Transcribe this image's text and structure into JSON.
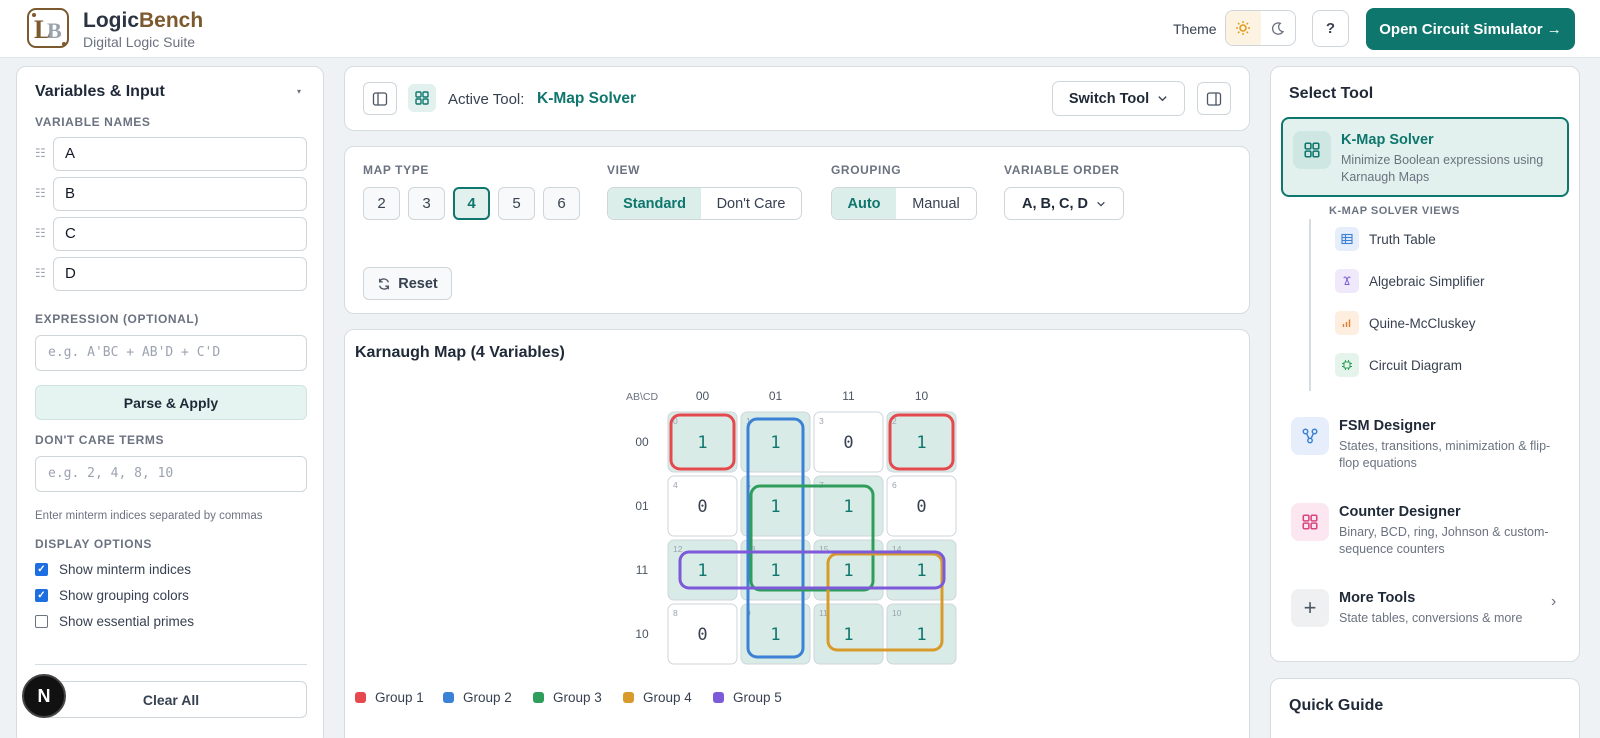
{
  "header": {
    "brand_logic": "Logic",
    "brand_bench": "Bench",
    "subtitle": "Digital Logic Suite",
    "theme_label": "Theme",
    "help_label": "?",
    "open_sim_label": "Open Circuit Simulator →"
  },
  "left_panel": {
    "title": "Variables & Input",
    "variable_names_label": "VARIABLE NAMES",
    "variables": [
      "A",
      "B",
      "C",
      "D"
    ],
    "expression_label": "EXPRESSION (OPTIONAL)",
    "expression_placeholder": "e.g. A'BC + AB'D + C'D",
    "parse_button": "Parse & Apply",
    "dont_care_label": "DON'T CARE TERMS",
    "dont_care_placeholder": "e.g. 2, 4, 8, 10",
    "dont_care_hint": "Enter minterm indices separated by commas",
    "display_options_label": "DISPLAY OPTIONS",
    "options": [
      {
        "label": "Show minterm indices",
        "checked": true
      },
      {
        "label": "Show grouping colors",
        "checked": true
      },
      {
        "label": "Show essential primes",
        "checked": false
      }
    ],
    "clear_button": "Clear All"
  },
  "toolbar": {
    "active_label": "Active Tool:",
    "active_tool": "K-Map Solver",
    "switch_label": "Switch Tool"
  },
  "controls": {
    "map_type_label": "MAP TYPE",
    "map_types": [
      "2",
      "3",
      "4",
      "5",
      "6"
    ],
    "map_type_selected": "4",
    "view_label": "VIEW",
    "view_options": [
      "Standard",
      "Don't Care"
    ],
    "view_selected": "Standard",
    "grouping_label": "GROUPING",
    "grouping_options": [
      "Auto",
      "Manual"
    ],
    "grouping_selected": "Auto",
    "order_label": "VARIABLE ORDER",
    "order_value": "A, B, C, D",
    "reset_label": "Reset"
  },
  "kmap": {
    "title": "Karnaugh Map (4 Variables)",
    "corner_label": "AB\\CD",
    "col_headers": [
      "00",
      "01",
      "11",
      "10"
    ],
    "row_headers": [
      "00",
      "01",
      "11",
      "10"
    ],
    "cells": [
      [
        {
          "idx": "0",
          "val": "1"
        },
        {
          "idx": "1",
          "val": "1"
        },
        {
          "idx": "3",
          "val": "0"
        },
        {
          "idx": "2",
          "val": "1"
        }
      ],
      [
        {
          "idx": "4",
          "val": "0"
        },
        {
          "idx": "5",
          "val": "1"
        },
        {
          "idx": "7",
          "val": "1"
        },
        {
          "idx": "6",
          "val": "0"
        }
      ],
      [
        {
          "idx": "12",
          "val": "1"
        },
        {
          "idx": "13",
          "val": "1"
        },
        {
          "idx": "15",
          "val": "1"
        },
        {
          "idx": "14",
          "val": "1"
        }
      ],
      [
        {
          "idx": "8",
          "val": "0"
        },
        {
          "idx": "9",
          "val": "1"
        },
        {
          "idx": "11",
          "val": "1"
        },
        {
          "idx": "10",
          "val": "1"
        }
      ]
    ],
    "groups": [
      {
        "name": "Group 1",
        "color": "#e5484d",
        "cells": [
          [
            0,
            0
          ],
          [
            0,
            3
          ]
        ]
      },
      {
        "name": "Group 2",
        "color": "#3b82d6",
        "cells": [
          [
            0,
            1
          ],
          [
            1,
            1
          ],
          [
            2,
            1
          ],
          [
            3,
            1
          ]
        ]
      },
      {
        "name": "Group 3",
        "color": "#2f9e5b",
        "cells": [
          [
            1,
            1
          ],
          [
            1,
            2
          ],
          [
            2,
            1
          ],
          [
            2,
            2
          ]
        ]
      },
      {
        "name": "Group 4",
        "color": "#d89b2b",
        "cells": [
          [
            2,
            2
          ],
          [
            2,
            3
          ],
          [
            3,
            2
          ],
          [
            3,
            3
          ]
        ]
      },
      {
        "name": "Group 5",
        "color": "#7c5ad9",
        "cells": [
          [
            2,
            0
          ],
          [
            2,
            1
          ],
          [
            2,
            2
          ],
          [
            2,
            3
          ]
        ]
      }
    ]
  },
  "right_panel": {
    "title": "Select Tool",
    "kmap_card": {
      "title": "K-Map Solver",
      "desc": "Minimize Boolean expressions using Karnaugh Maps"
    },
    "views_label": "K-MAP SOLVER VIEWS",
    "views": [
      {
        "label": "Truth Table",
        "icon": "table-icon"
      },
      {
        "label": "Algebraic Simplifier",
        "icon": "function-icon"
      },
      {
        "label": "Quine-McCluskey",
        "icon": "bar-chart-icon"
      },
      {
        "label": "Circuit Diagram",
        "icon": "chip-icon"
      }
    ],
    "fsm_card": {
      "title": "FSM Designer",
      "desc": "States, transitions, minimization & flip-flop equations"
    },
    "counter_card": {
      "title": "Counter Designer",
      "desc": "Binary, BCD, ring, Johnson & custom-sequence counters"
    },
    "more_card": {
      "title": "More Tools",
      "desc": "State tables, conversions & more"
    }
  },
  "quick_guide": {
    "title": "Quick Guide"
  }
}
